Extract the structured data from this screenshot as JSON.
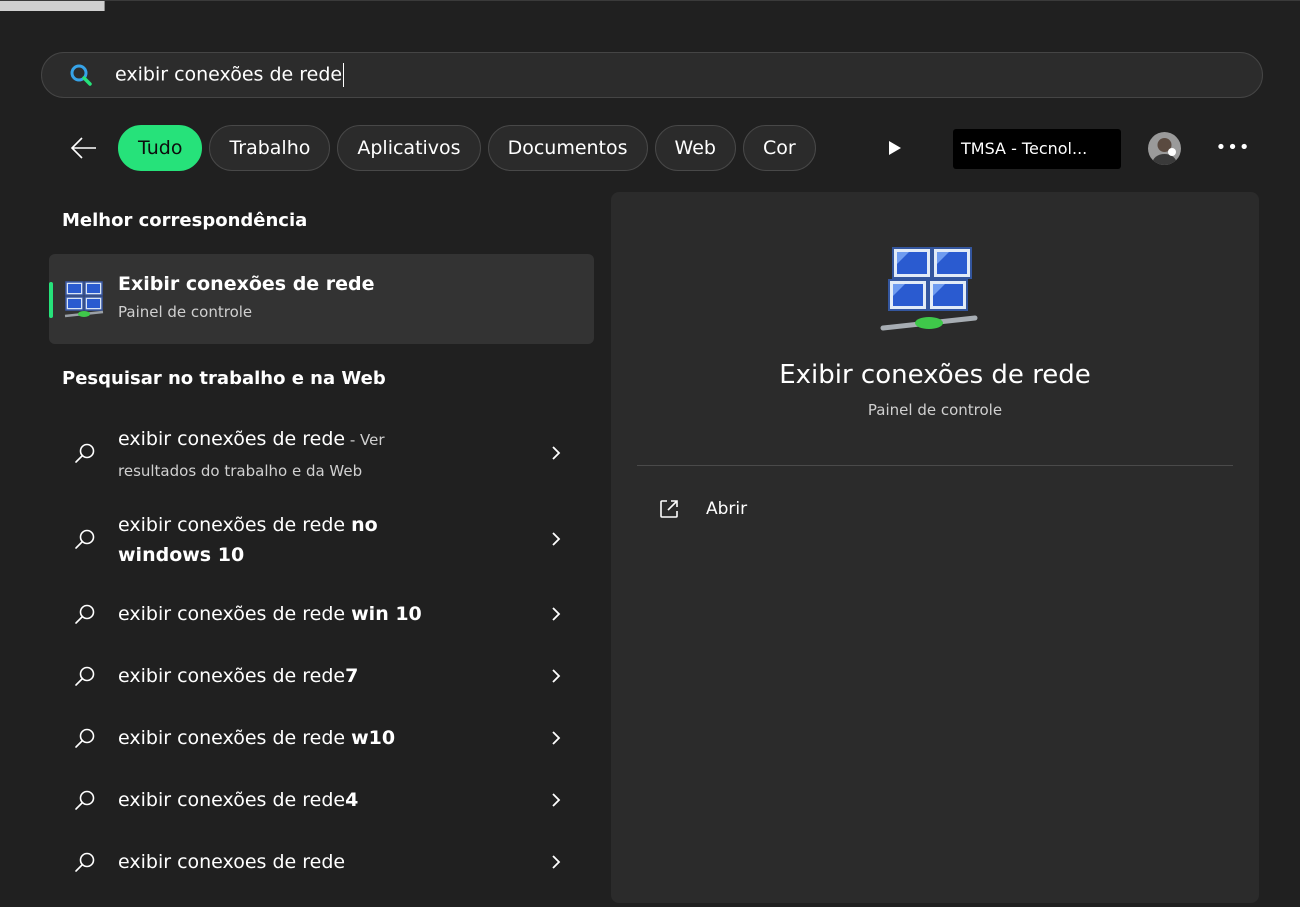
{
  "search": {
    "query": "exibir conexões de rede",
    "icon": "search-icon",
    "accent_color": "#26e27a"
  },
  "filters": {
    "chips": [
      {
        "label": "Tudo",
        "active": true
      },
      {
        "label": "Trabalho",
        "active": false
      },
      {
        "label": "Aplicativos",
        "active": false
      },
      {
        "label": "Documentos",
        "active": false
      },
      {
        "label": "Web",
        "active": false
      },
      {
        "label": "Cor",
        "active": false
      }
    ],
    "organization": "TMSA - Tecnol..."
  },
  "best_match": {
    "heading": "Melhor correspondência",
    "title": "Exibir conexões de rede",
    "subtitle": "Painel de controle",
    "icon": "network-connections-icon"
  },
  "web_search": {
    "heading": "Pesquisar no trabalho e na Web",
    "items": [
      {
        "base": "exibir conexões de rede",
        "bold": "",
        "suffix": " - Ver resultados do trabalho e da Web"
      },
      {
        "base": "exibir conexões de rede ",
        "bold": "no windows 10",
        "suffix": ""
      },
      {
        "base": "exibir conexões de rede ",
        "bold": "win 10",
        "suffix": ""
      },
      {
        "base": "exibir conexões de rede",
        "bold": "7",
        "suffix": ""
      },
      {
        "base": "exibir conexões de rede ",
        "bold": "w10",
        "suffix": ""
      },
      {
        "base": "exibir conexões de rede",
        "bold": "4",
        "suffix": ""
      },
      {
        "base": "exibir conexoes de rede",
        "bold": "",
        "suffix": ""
      }
    ]
  },
  "preview": {
    "title": "Exibir conexões de rede",
    "subtitle": "Painel de controle",
    "actions": [
      {
        "label": "Abrir",
        "icon": "open-external-icon"
      }
    ]
  }
}
